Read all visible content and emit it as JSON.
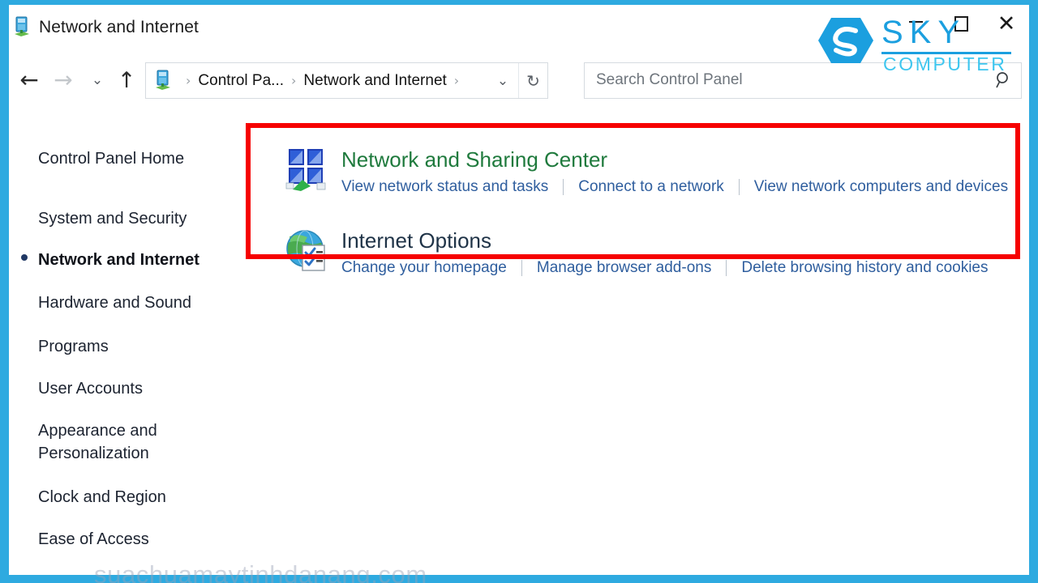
{
  "window": {
    "title": "Network and Internet",
    "title_icon": "control-panel-network-icon",
    "controls": {
      "minimize": "─",
      "maximize": "□",
      "close": "✕"
    }
  },
  "nav": {
    "back": "←",
    "forward": "→",
    "recent": "⌄",
    "up": "↑",
    "chevron": "⌄",
    "refresh": "↻"
  },
  "breadcrumb": {
    "separator": "›",
    "items": [
      "Control Pa...",
      "Network and Internet"
    ],
    "trailing_separator": "›"
  },
  "search": {
    "placeholder": "Search Control Panel",
    "icon": "magnifier-icon"
  },
  "sidebar": {
    "items": [
      {
        "label": "Control Panel Home",
        "selected": false
      },
      {
        "label": "System and Security",
        "selected": false
      },
      {
        "label": "Network and Internet",
        "selected": true
      },
      {
        "label": "Hardware and Sound",
        "selected": false
      },
      {
        "label": "Programs",
        "selected": false
      },
      {
        "label": "User Accounts",
        "selected": false
      },
      {
        "label": "Appearance and\nPersonalization",
        "selected": false
      },
      {
        "label": "Clock and Region",
        "selected": false
      },
      {
        "label": "Ease of Access",
        "selected": false
      }
    ]
  },
  "categories": [
    {
      "title": "Network and Sharing Center",
      "icon": "network-sharing-center-icon",
      "links": [
        "View network status and tasks",
        "Connect to a network",
        "View network computers and devices"
      ]
    },
    {
      "title": "Internet Options",
      "icon": "internet-options-globe-icon",
      "links": [
        "Change your homepage",
        "Manage browser add-ons",
        "Delete browsing history and cookies"
      ]
    }
  ],
  "annotation": {
    "color": "#f60000",
    "label": "highlight-rectangle"
  },
  "watermarks": {
    "site": "suachuamaytinhdanang.com",
    "logo_title": "SKY",
    "logo_subtitle": "COMPUTER",
    "logo_color": "#1b9fdf"
  }
}
